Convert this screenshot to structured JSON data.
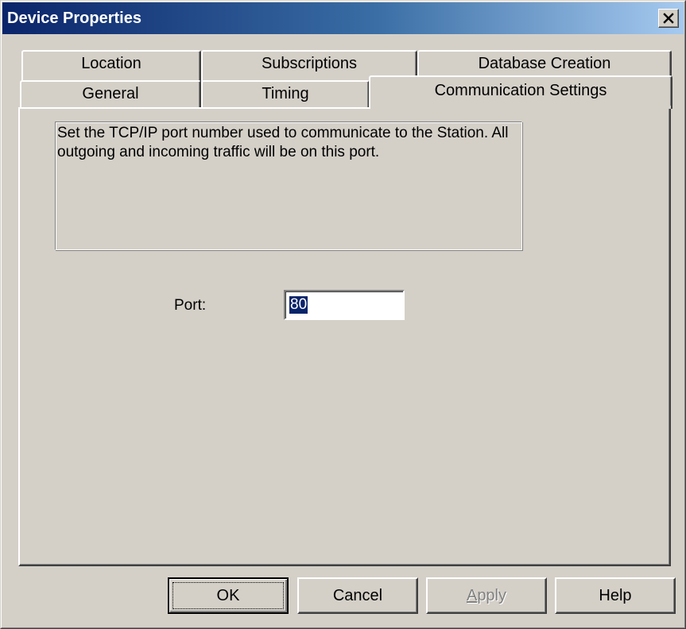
{
  "window": {
    "title": "Device Properties",
    "close_glyph": "✕"
  },
  "tabs": {
    "back_row": [
      {
        "label": "Location"
      },
      {
        "label": "Subscriptions"
      },
      {
        "label": "Database Creation"
      }
    ],
    "front_row": [
      {
        "label": "General"
      },
      {
        "label": "Timing"
      },
      {
        "label": "Communication Settings"
      }
    ],
    "active": "Communication Settings"
  },
  "panel": {
    "description": "Set the TCP/IP port number used to communicate to the Station. All outgoing and incoming traffic will be on this port.",
    "port_label": "Port:",
    "port_value": "80"
  },
  "buttons": {
    "ok": "OK",
    "cancel": "Cancel",
    "apply_mnemonic": "A",
    "apply_rest": "pply",
    "help": "Help",
    "apply_enabled": false
  },
  "colors": {
    "titlebar_start": "#0a246a",
    "titlebar_end": "#a6caf0",
    "face": "#d4d0c8",
    "selection": "#0a246a"
  }
}
